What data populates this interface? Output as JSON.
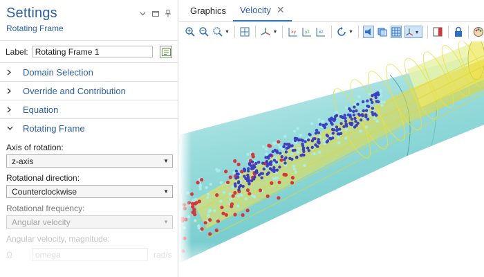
{
  "settings": {
    "title": "Settings",
    "subtitle": "Rotating Frame",
    "label_caption": "Label:",
    "label_value": "Rotating Frame 1",
    "sections": [
      {
        "label": "Domain Selection",
        "expanded": false
      },
      {
        "label": "Override and Contribution",
        "expanded": false
      },
      {
        "label": "Equation",
        "expanded": false
      },
      {
        "label": "Rotating Frame",
        "expanded": true
      }
    ],
    "axis_label": "Axis of rotation:",
    "axis_value": "z-axis",
    "direction_label": "Rotational direction:",
    "direction_value": "Counterclockwise",
    "frequency_label": "Rotational frequency:",
    "frequency_value": "Angular velocity",
    "magnitude_label": "Angular velocity, magnitude:",
    "magnitude_symbol": "Ω",
    "magnitude_value": "omega",
    "magnitude_unit": "rad/s"
  },
  "graphics": {
    "tabs": [
      {
        "label": "Graphics",
        "active": false
      },
      {
        "label": "Velocity",
        "active": true
      }
    ],
    "toolbar_icons": [
      "zoom-in-icon",
      "zoom-out-icon",
      "zoom-box-icon",
      "zoom-extents-icon",
      "view-axes-icon",
      "xy-view-icon",
      "yz-view-icon",
      "xz-view-icon",
      "rotate-icon",
      "scene-light-icon",
      "transparency-icon",
      "mesh-icon",
      "axis-orientation-icon",
      "camera-icon",
      "lock-icon",
      "palette-icon"
    ]
  },
  "colors": {
    "accent": "#2a5fa8",
    "tab_active": "#2a7de0",
    "pipe_outer": "#7fd6d6",
    "streamlines": "#e8e23a",
    "particle_red": "#d9343a",
    "particle_blue": "#3d3fc2",
    "particle_cyan": "#a8ecec"
  }
}
